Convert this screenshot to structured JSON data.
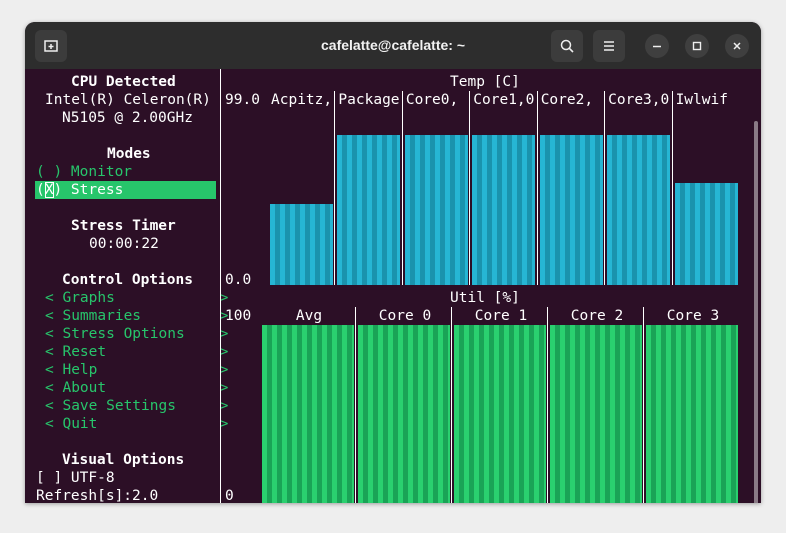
{
  "window": {
    "title": "cafelatte@cafelatte: ~",
    "buttons": {
      "new_tab": "new-tab-icon",
      "search": "search-icon",
      "menu": "hamburger-icon",
      "minimize": "minimize-icon",
      "maximize": "maximize-icon",
      "close": "close-icon"
    }
  },
  "sidebar": {
    "cpu_heading": "CPU Detected",
    "cpu_line1": "Intel(R) Celeron(R)",
    "cpu_line2": "N5105 @ 2.00GHz",
    "modes_heading": "Modes",
    "mode_monitor": "( ) Monitor",
    "mode_stress": "(X) Stress",
    "stress_timer_heading": "Stress Timer",
    "stress_timer_value": "00:00:22",
    "control_heading": "Control Options",
    "controls": [
      {
        "label": "< Graphs            >"
      },
      {
        "label": "< Summaries         >"
      },
      {
        "label": "< Stress Options    >"
      },
      {
        "label": "< Reset             >"
      },
      {
        "label": "< Help              >"
      },
      {
        "label": "< About             >"
      },
      {
        "label": "< Save Settings     >"
      },
      {
        "label": "< Quit              >"
      }
    ],
    "visual_heading": "Visual Options",
    "utf8_option": "[ ] UTF-8",
    "refresh": "Refresh[s]:2.0"
  },
  "temp_graph": {
    "title": "Temp [C]",
    "max_label": "99.0",
    "min_label": "0.0",
    "columns": [
      "Acpitz,",
      "Package",
      "Core0,",
      "Core1,0",
      "Core2,",
      "Core3,0",
      "Iwlwif"
    ],
    "levels": [
      0.46,
      0.85,
      0.85,
      0.85,
      0.85,
      0.85,
      0.58
    ],
    "colors": {
      "bar": "#26b6d4",
      "bar_dark": "#1a93ad"
    }
  },
  "util_graph": {
    "title": "Util [%]",
    "max_label": "100",
    "min_label": "0",
    "columns": [
      "Avg",
      "Core 0",
      "Core 1",
      "Core 2",
      "Core 3"
    ],
    "levels": [
      1.0,
      1.0,
      1.0,
      1.0,
      1.0
    ],
    "colors": {
      "bar": "#2ad06f",
      "bar_dark": "#1aa356"
    }
  },
  "colors": {
    "background": "#2c0f26",
    "accent_green": "#27c56b",
    "titlebar": "#2d2d2d"
  }
}
